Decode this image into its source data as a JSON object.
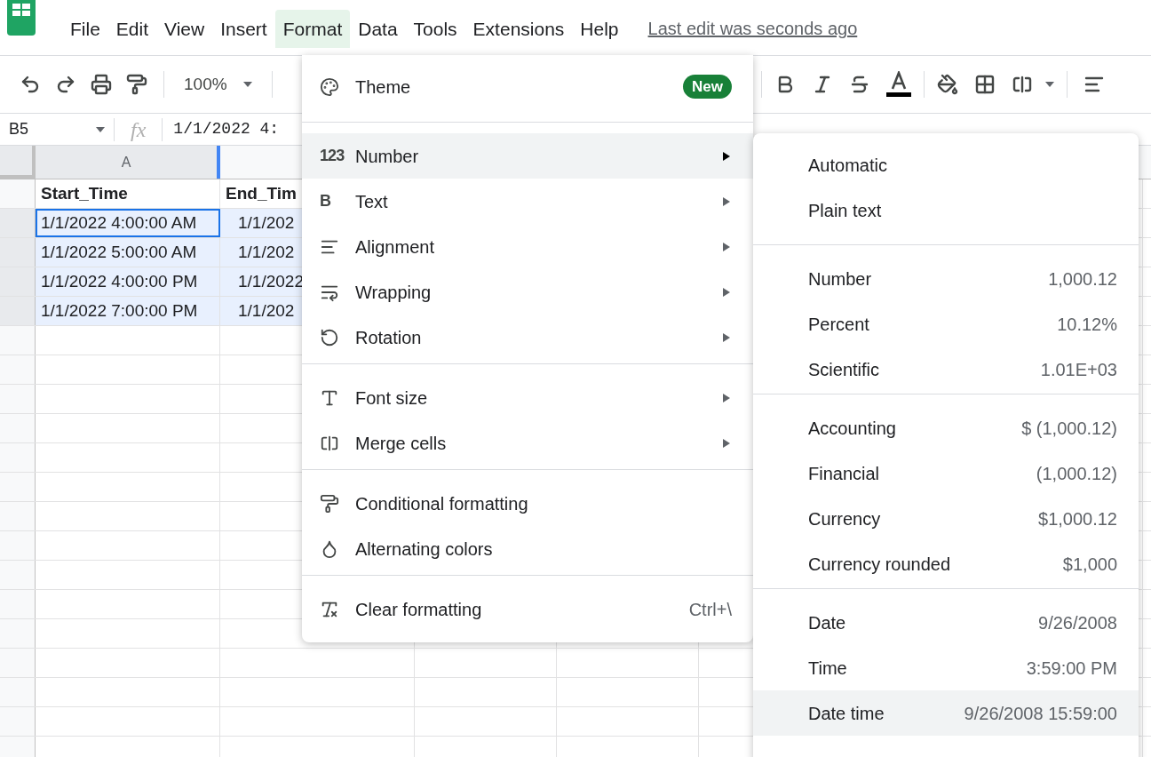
{
  "menubar": {
    "items": [
      {
        "label": "File",
        "selected": false
      },
      {
        "label": "Edit",
        "selected": false
      },
      {
        "label": "View",
        "selected": false
      },
      {
        "label": "Insert",
        "selected": false
      },
      {
        "label": "Format",
        "selected": true
      },
      {
        "label": "Data",
        "selected": false
      },
      {
        "label": "Tools",
        "selected": false
      },
      {
        "label": "Extensions",
        "selected": false
      },
      {
        "label": "Help",
        "selected": false
      }
    ],
    "last_edit": "Last edit was seconds ago"
  },
  "toolbar": {
    "zoom": "100%"
  },
  "formula_bar": {
    "cell_ref": "B5",
    "fx": "fx",
    "value": "1/1/2022 4:"
  },
  "sheet": {
    "columns": [
      "A"
    ],
    "rows": [
      {
        "cells": [
          "Start_Time",
          "End_Tim"
        ],
        "header": true,
        "selected": false,
        "active": false
      },
      {
        "cells": [
          "1/1/2022 4:00:00 AM",
          "1/1/202"
        ],
        "header": false,
        "selected": true,
        "active": true
      },
      {
        "cells": [
          "1/1/2022 5:00:00 AM",
          "1/1/202"
        ],
        "header": false,
        "selected": true,
        "active": false
      },
      {
        "cells": [
          "1/1/2022 4:00:00 PM",
          "1/1/2022"
        ],
        "header": false,
        "selected": true,
        "active": false
      },
      {
        "cells": [
          "1/1/2022 7:00:00 PM",
          "1/1/202"
        ],
        "header": false,
        "selected": true,
        "active": false
      }
    ]
  },
  "format_menu": {
    "sections": [
      {
        "items": [
          {
            "label": "Theme",
            "badge": "New",
            "submenu": false,
            "selected": false
          }
        ]
      },
      {
        "items": [
          {
            "icon_text": "123",
            "label": "Number",
            "submenu": true,
            "selected": true
          },
          {
            "icon_text": "B",
            "label": "Text",
            "submenu": true,
            "selected": false
          },
          {
            "label": "Alignment",
            "submenu": true,
            "selected": false
          },
          {
            "label": "Wrapping",
            "submenu": true,
            "selected": false
          },
          {
            "label": "Rotation",
            "submenu": true,
            "selected": false
          }
        ]
      },
      {
        "items": [
          {
            "label": "Font size",
            "submenu": true,
            "selected": false
          },
          {
            "label": "Merge cells",
            "submenu": true,
            "selected": false
          }
        ]
      },
      {
        "items": [
          {
            "label": "Conditional formatting",
            "submenu": false,
            "selected": false
          },
          {
            "label": "Alternating colors",
            "submenu": false,
            "selected": false
          }
        ]
      },
      {
        "items": [
          {
            "label": "Clear formatting",
            "shortcut": "Ctrl+\\",
            "submenu": false,
            "selected": false
          }
        ]
      }
    ]
  },
  "number_submenu": {
    "sections": [
      {
        "items": [
          {
            "label": "Automatic",
            "selected": false
          },
          {
            "label": "Plain text",
            "selected": false
          }
        ]
      },
      {
        "items": [
          {
            "label": "Number",
            "example": "1,000.12",
            "selected": false
          },
          {
            "label": "Percent",
            "example": "10.12%",
            "selected": false
          },
          {
            "label": "Scientific",
            "example": "1.01E+03",
            "selected": false
          }
        ]
      },
      {
        "items": [
          {
            "label": "Accounting",
            "example": "$ (1,000.12)",
            "selected": false
          },
          {
            "label": "Financial",
            "example": "(1,000.12)",
            "selected": false
          },
          {
            "label": "Currency",
            "example": "$1,000.12",
            "selected": false
          },
          {
            "label": "Currency rounded",
            "example": "$1,000",
            "selected": false
          }
        ]
      },
      {
        "items": [
          {
            "label": "Date",
            "example": "9/26/2008",
            "selected": false
          },
          {
            "label": "Time",
            "example": "3:59:00 PM",
            "selected": false
          },
          {
            "label": "Date time",
            "example": "9/26/2008 15:59:00",
            "selected": true
          }
        ]
      }
    ]
  }
}
